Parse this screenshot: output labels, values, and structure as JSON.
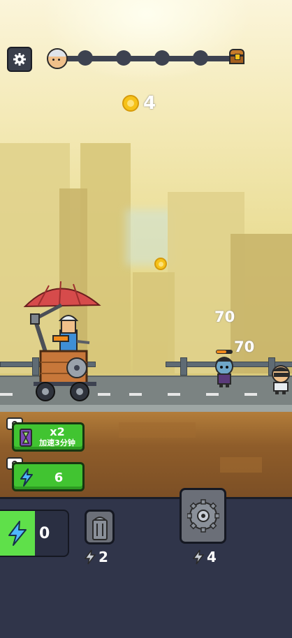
{
  "hud": {
    "coins": "4",
    "icons": {
      "settings": "gear-icon",
      "coin": "coin-icon",
      "start": "player-head-icon",
      "goal": "treasure-chest-icon"
    },
    "progress_nodes": 4
  },
  "damage_numbers": [
    "70",
    "70"
  ],
  "buffs": {
    "speed": {
      "multiplier": "x2",
      "caption": "加速3分钟"
    },
    "energy_ad": {
      "value": "6"
    }
  },
  "panel": {
    "energy": "0",
    "slots": [
      {
        "name": "trash-can",
        "cost": "2"
      },
      {
        "name": "saw-blade",
        "cost": "4"
      }
    ]
  },
  "colors": {
    "accent_green": "#41c431",
    "panel": "#30354a",
    "coin": "#f6c219"
  }
}
